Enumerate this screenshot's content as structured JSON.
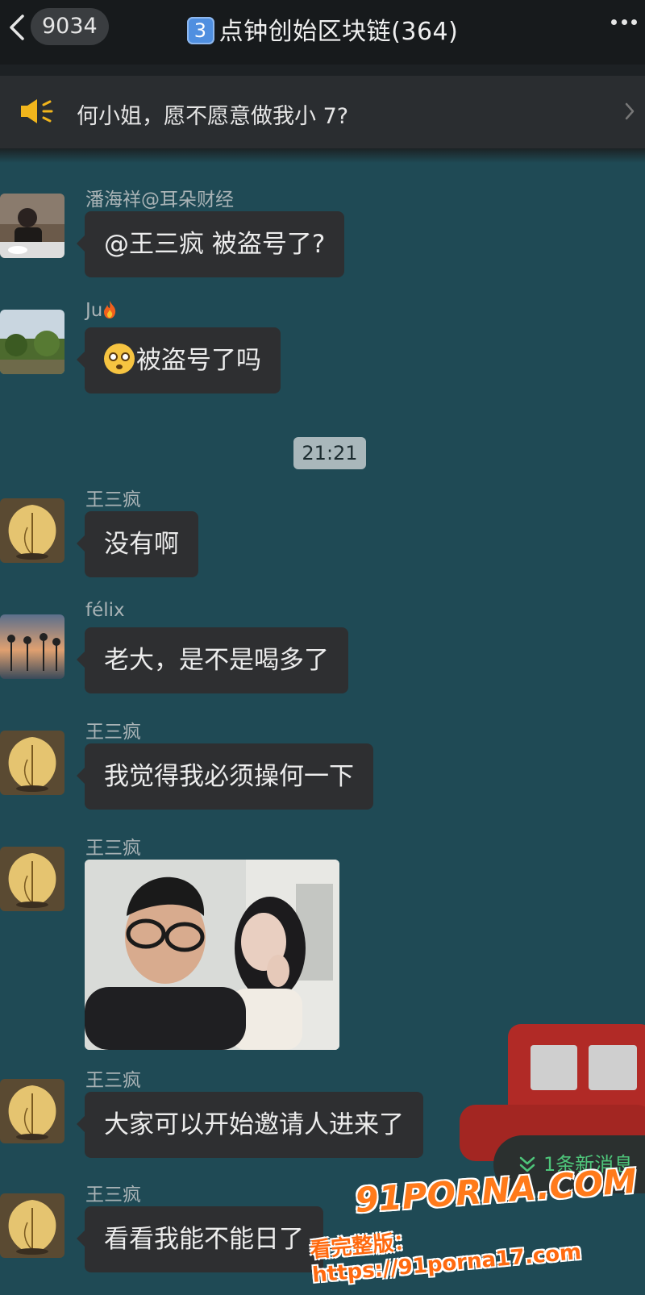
{
  "header": {
    "unread_count": "9034",
    "badge_number": "3",
    "title": "点钟创始区块链(364)"
  },
  "notice": {
    "text": "何小姐，愿不愿意做我小 7?"
  },
  "messages": [
    {
      "sender": "潘海祥@耳朵财经",
      "text": "@王三疯 被盗号了?"
    },
    {
      "sender": "Ju",
      "text": "被盗号了吗"
    },
    {
      "sender": "王三疯",
      "text": "没有啊"
    },
    {
      "sender": "félix",
      "text": "老大，是不是喝多了"
    },
    {
      "sender": "王三疯",
      "text": "我觉得我必须操何一下"
    },
    {
      "sender": "王三疯",
      "text": ""
    },
    {
      "sender": "王三疯",
      "text": "大家可以开始邀请人进来了"
    },
    {
      "sender": "王三疯",
      "text": "看看我能不能日了"
    }
  ],
  "timestamp": "21:21",
  "new_message_pill": "1条新消息",
  "watermark": {
    "logo": "91PORNA.COM",
    "url": "看完整版：https://91porna17.com"
  },
  "colors": {
    "chat_background": "#1f4a55",
    "bubble": "#2e2f31",
    "header": "#171a1c",
    "accent_green": "#4ec57a",
    "watermark_orange": "#ff7a1a"
  },
  "icons": [
    "back-chevron-icon",
    "more-icon",
    "speaker-icon",
    "chevron-right-icon",
    "fire-icon",
    "flushed-face-icon",
    "double-chevron-down-icon"
  ]
}
